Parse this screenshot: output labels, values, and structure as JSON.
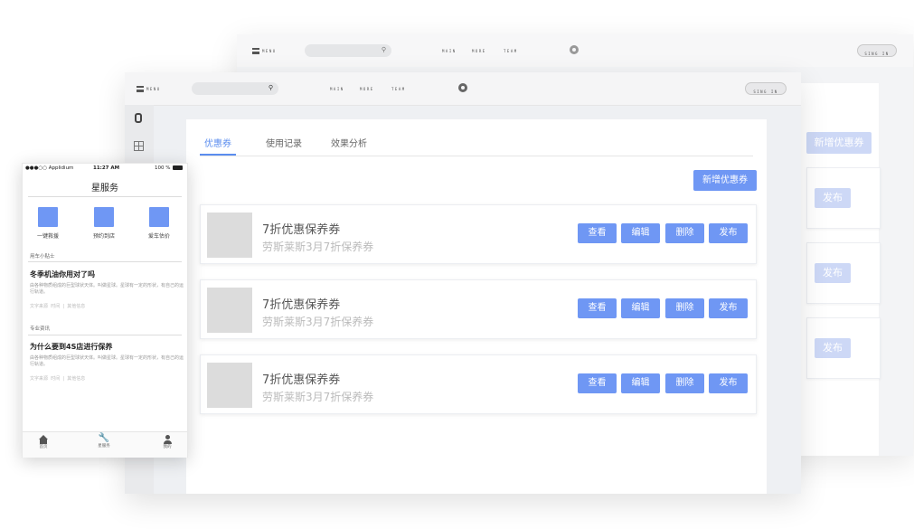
{
  "back_window": {
    "nav": {
      "menu_label": "MENU",
      "links": [
        "MAIN",
        "MORE",
        "TEAM"
      ],
      "sign_in_label": "SING IN"
    },
    "add_coupon_label": "新增优惠券",
    "publish_label": "发布"
  },
  "main_window": {
    "nav": {
      "menu_label": "MENU",
      "links": [
        "MAIN",
        "MORE",
        "TEAM"
      ],
      "sign_in_label": "SING IN"
    },
    "tabs": [
      {
        "label": "优惠券",
        "active": true
      },
      {
        "label": "使用记录",
        "active": false
      },
      {
        "label": "效果分析",
        "active": false
      }
    ],
    "add_coupon_label": "新增优惠券",
    "coupons": [
      {
        "title": "7折优惠保养券",
        "subtitle": "劳斯莱斯3月7折保养券"
      },
      {
        "title": "7折优惠保养券",
        "subtitle": "劳斯莱斯3月7折保养券"
      },
      {
        "title": "7折优惠保养券",
        "subtitle": "劳斯莱斯3月7折保养券"
      }
    ],
    "actions": {
      "view": "查看",
      "edit": "编辑",
      "delete": "删除",
      "publish": "发布"
    }
  },
  "phone": {
    "status": {
      "carrier": "●●●○○ Applidium",
      "time": "11:27 AM",
      "battery": "100 %"
    },
    "title": "星服务",
    "quick_actions": [
      {
        "label": "一键救援",
        "icon": "rescue-icon"
      },
      {
        "label": "预约到店",
        "icon": "appointment-icon"
      },
      {
        "label": "爱车估价",
        "icon": "valuation-icon"
      }
    ],
    "sections": [
      {
        "heading": "用车小贴士",
        "article": {
          "title": "冬季机油你用对了吗",
          "body": "由各种物质组成的巨型球状天体。叫做星球。星球有一定的形状，有自己的运行轨道。",
          "source": "文字来源",
          "time": "时间",
          "other": "其他信息"
        }
      },
      {
        "heading": "专业资讯",
        "article": {
          "title": "为什么要到4S店进行保养",
          "body": "由各种物质组成的巨型球状天体。叫做星球。星球有一定的形状，有自己的运行轨道。",
          "source": "文字来源",
          "time": "时间",
          "other": "其他信息"
        }
      }
    ],
    "tabbar": [
      {
        "label": "首页",
        "icon": "home-icon"
      },
      {
        "label": "星服务",
        "icon": "wrench-icon"
      },
      {
        "label": "我的",
        "icon": "user-icon"
      }
    ]
  },
  "colors": {
    "accent": "#6f97f4",
    "accent_ghost": "#cdd8f6",
    "thumb": "#dcdcdc"
  }
}
